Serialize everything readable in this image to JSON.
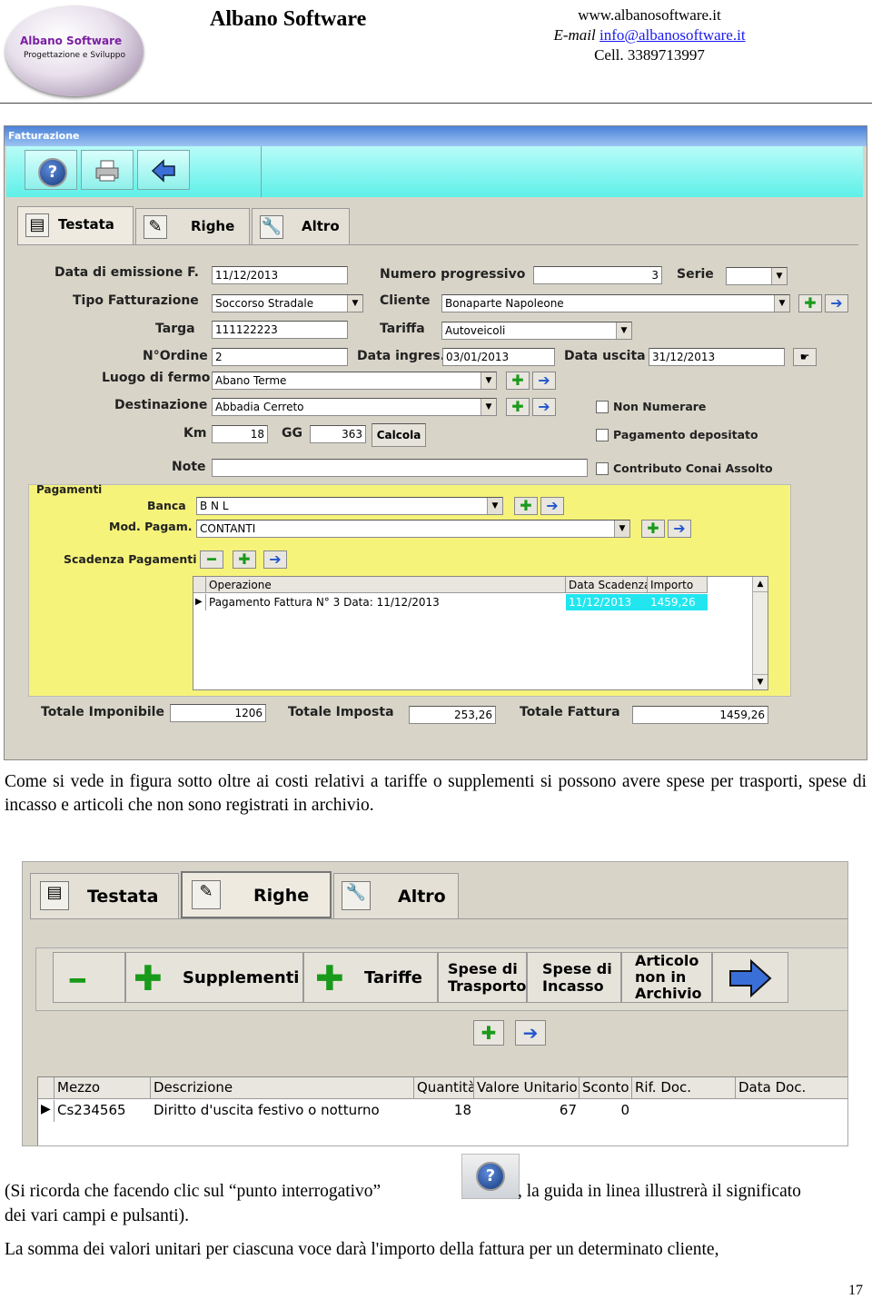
{
  "header": {
    "logo_line1": "Albano Software",
    "logo_line2": "Progettazione e Sviluppo",
    "brand": "Albano Software",
    "website": "www.albanosoftware.it",
    "email_label": "E-mail",
    "email": "info@albanosoftware.it",
    "cell": "Cell. 3389713997"
  },
  "window1": {
    "title": "Fatturazione",
    "tabs": [
      {
        "label": "Testata",
        "icon": "notebook-icon"
      },
      {
        "label": "Righe",
        "icon": "notepad-pencil-icon"
      },
      {
        "label": "Altro",
        "icon": "wrench-icon"
      }
    ],
    "fields": {
      "data_emissione_label": "Data di emissione F.",
      "data_emissione": "11/12/2013",
      "numero_progressivo_label": "Numero progressivo",
      "numero_progressivo": "3",
      "serie_label": "Serie",
      "serie": "",
      "tipo_fatturazione_label": "Tipo Fatturazione",
      "tipo_fatturazione": "Soccorso Stradale",
      "cliente_label": "Cliente",
      "cliente": "Bonaparte Napoleone",
      "targa_label": "Targa",
      "targa": "111122223",
      "tariffa_label": "Tariffa",
      "tariffa": "Autoveicoli",
      "nordine_label": "N°Ordine",
      "nordine": "2",
      "data_ingres_label": "Data ingres.",
      "data_ingres": "03/01/2013",
      "data_uscita_label": "Data uscita",
      "data_uscita": "31/12/2013",
      "luogo_fermo_label": "Luogo di fermo",
      "luogo_fermo": "Abano Terme",
      "destinazione_label": "Destinazione",
      "destinazione": "Abbadia Cerreto",
      "km_label": "Km",
      "km": "18",
      "gg_label": "GG",
      "gg": "363",
      "calcola": "Calcola",
      "note_label": "Note",
      "note": "",
      "non_numerare": "Non Numerare",
      "pagamento_depositato": "Pagamento depositato",
      "contributo_conai": "Contributo Conai Assolto"
    },
    "pagamenti": {
      "title": "Pagamenti",
      "banca_label": "Banca",
      "banca": "B N L",
      "mod_pagam_label": "Mod. Pagam.",
      "mod_pagam": "CONTANTI",
      "scadenza_label": "Scadenza Pagamenti",
      "columns": [
        "Operazione",
        "Data Scadenza",
        "Importo"
      ],
      "rows": [
        {
          "operazione": "Pagamento Fattura  N° 3  Data: 11/12/2013",
          "data_scadenza": "11/12/2013",
          "importo": "1459,26"
        }
      ]
    },
    "totals": {
      "imponibile_label": "Totale Imponibile",
      "imponibile": "1206",
      "imposta_label": "Totale Imposta",
      "imposta": "253,26",
      "fattura_label": "Totale Fattura",
      "fattura": "1459,26"
    }
  },
  "para1": "Come si vede in figura sotto oltre ai costi relativi a tariffe o supplementi si possono avere spese per trasporti, spese di incasso e articoli che non sono registrati in archivio.",
  "window2": {
    "tabs": [
      "Testata",
      "Righe",
      "Altro"
    ],
    "buttons": {
      "supplementi": "Supplementi",
      "tariffe": "Tariffe",
      "spese_trasporto": "Spese di Trasporto",
      "spese_incasso": "Spese di Incasso",
      "articolo_non_archivio": "Articolo non in Archivio"
    },
    "columns": [
      "Mezzo",
      "Descrizione",
      "Quantità",
      "Valore Unitario",
      "Sconto",
      "Rif. Doc.",
      "Data Doc."
    ],
    "rows": [
      {
        "mezzo": "Cs234565",
        "descrizione": "Diritto d'uscita festivo o notturno",
        "quantita": "18",
        "valore_unitario": "67",
        "sconto": "0",
        "rif_doc": "",
        "data_doc": ""
      }
    ]
  },
  "para2_a": "(Si ricorda che facendo clic sul “punto interrogativo”",
  "para2_b": ", la guida in linea illustrerà il significato",
  "para2_c": "dei vari campi e pulsanti).",
  "para3": "La somma dei valori unitari per ciascuna voce darà l'importo della fattura per un determinato cliente,",
  "page_number": "17"
}
